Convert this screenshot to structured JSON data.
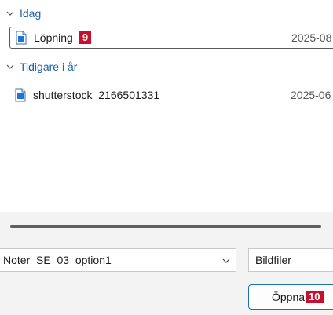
{
  "groups": [
    {
      "label": "Idag",
      "files": [
        {
          "name": "Löpning",
          "badge": "9",
          "date": "2025-08",
          "selected": true
        }
      ]
    },
    {
      "label": "Tidigare i år",
      "files": [
        {
          "name": "shutterstock_2166501331",
          "date": "2025-06",
          "selected": false
        }
      ]
    }
  ],
  "footer": {
    "filename_value": "Noter_SE_03_option1",
    "filetype_label": "Bildfiler",
    "open_label": "Öppna",
    "open_badge": "10"
  },
  "colors": {
    "accent": "#1f5fa8",
    "badge": "#c8102e",
    "footer_bg": "#f3f3f3"
  }
}
